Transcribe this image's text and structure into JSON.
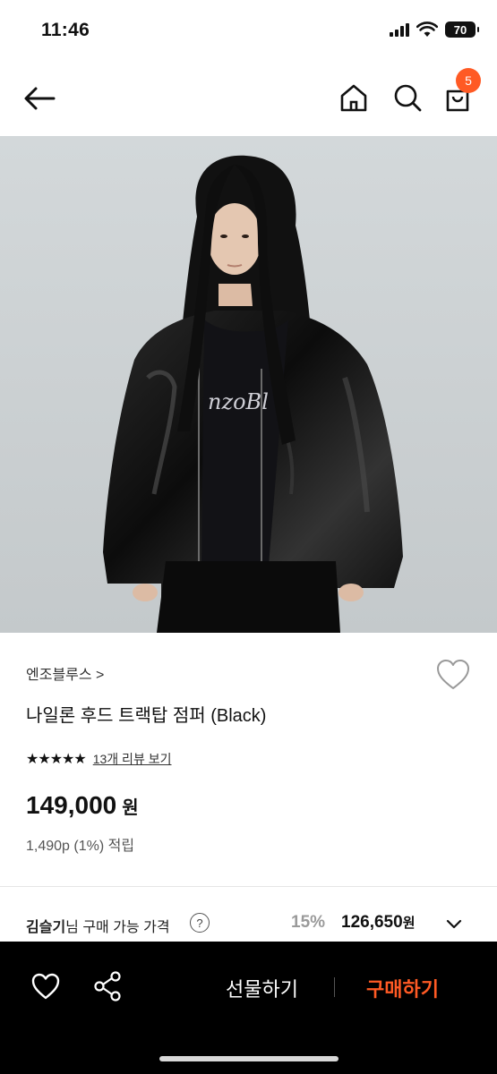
{
  "status_bar": {
    "time": "11:46",
    "battery": "70"
  },
  "nav": {
    "cart_count": "5"
  },
  "product": {
    "brand": "엔조블루스 >",
    "title": "나일론 후드 트랙탑 점퍼 (Black)",
    "rating_stars": "★★★★★",
    "rating_value": 4.5,
    "review_link": "13개 리뷰 보기",
    "price": "149,000",
    "price_unit": "원",
    "points": "1,490p (1%) 적립",
    "shirt_logo_text": "nzoBl"
  },
  "member_price": {
    "name": "김슬기",
    "label_suffix": "님 구매 가능 가격",
    "help": "?",
    "discount": "15%",
    "price": "126,650",
    "unit": "원"
  },
  "bottom_bar": {
    "gift_label": "선물하기",
    "buy_label": "구매하기"
  },
  "colors": {
    "accent": "#ff5a24",
    "bottom_bar_bg": "#000000"
  }
}
